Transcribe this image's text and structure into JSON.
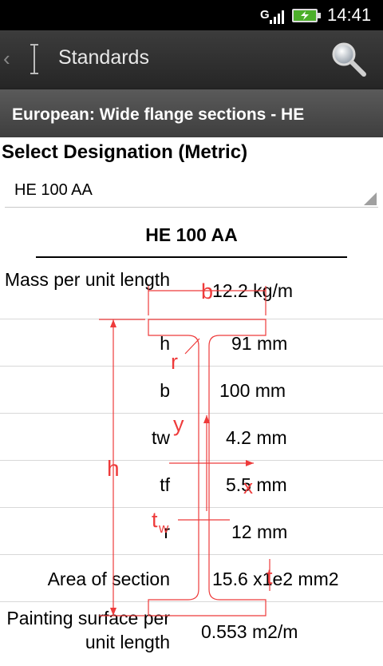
{
  "status": {
    "network": "G",
    "time": "14:41"
  },
  "actionbar": {
    "title": "Standards",
    "back_icon": "chevron-left-icon",
    "app_icon": "text-cursor-icon",
    "search_icon": "search-icon"
  },
  "section": {
    "title": "European: Wide flange sections - HE"
  },
  "select": {
    "label": "Select Designation (Metric)",
    "value": "HE 100 AA"
  },
  "designation_title": "HE 100 AA",
  "properties": [
    {
      "label": "Mass per unit length",
      "value": "12.2 kg/m"
    },
    {
      "label": "h",
      "value": "91 mm"
    },
    {
      "label": "b",
      "value": "100 mm"
    },
    {
      "label": "tw",
      "value": "4.2 mm"
    },
    {
      "label": "tf",
      "value": "5.5 mm"
    },
    {
      "label": "r",
      "value": "12 mm"
    },
    {
      "label": "Area of section",
      "value": "15.6 x1e2 mm2"
    },
    {
      "label": "Painting surface per unit length",
      "value": "0.553 m2/m"
    }
  ],
  "diagram": {
    "labels": {
      "b": "b",
      "r": "r",
      "y": "y",
      "h": "h",
      "x": "x",
      "tw": "t",
      "tw_sub": "w",
      "tf": "t"
    },
    "color": "#ee3b3b"
  }
}
